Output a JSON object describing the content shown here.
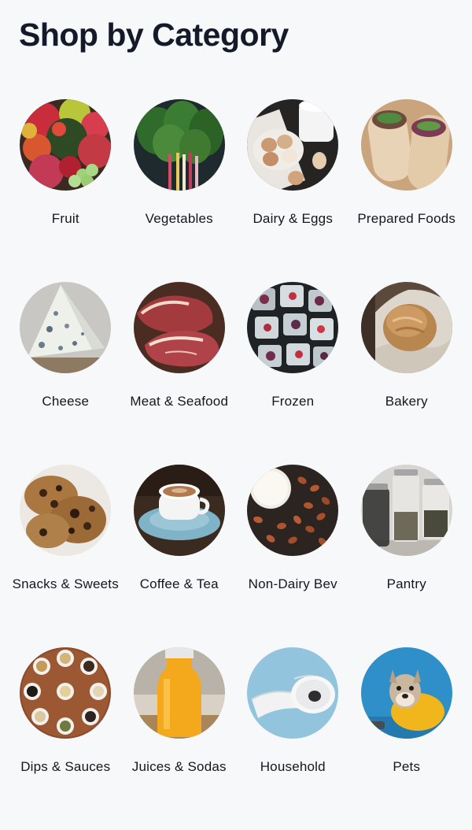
{
  "title": "Shop by Category",
  "categories": [
    {
      "label": "Fruit",
      "icon": "fruit-icon"
    },
    {
      "label": "Vegetables",
      "icon": "vegetables-icon"
    },
    {
      "label": "Dairy & Eggs",
      "icon": "dairy-eggs-icon"
    },
    {
      "label": "Prepared Foods",
      "icon": "prepared-foods-icon"
    },
    {
      "label": "Cheese",
      "icon": "cheese-icon"
    },
    {
      "label": "Meat & Seafood",
      "icon": "meat-seafood-icon"
    },
    {
      "label": "Frozen",
      "icon": "frozen-icon"
    },
    {
      "label": "Bakery",
      "icon": "bakery-icon"
    },
    {
      "label": "Snacks & Sweets",
      "icon": "snacks-sweets-icon"
    },
    {
      "label": "Coffee & Tea",
      "icon": "coffee-tea-icon"
    },
    {
      "label": "Non-Dairy Bev",
      "icon": "non-dairy-bev-icon"
    },
    {
      "label": "Pantry",
      "icon": "pantry-icon"
    },
    {
      "label": "Dips & Sauces",
      "icon": "dips-sauces-icon"
    },
    {
      "label": "Juices & Sodas",
      "icon": "juices-sodas-icon"
    },
    {
      "label": "Household",
      "icon": "household-icon"
    },
    {
      "label": "Pets",
      "icon": "pets-icon"
    }
  ]
}
